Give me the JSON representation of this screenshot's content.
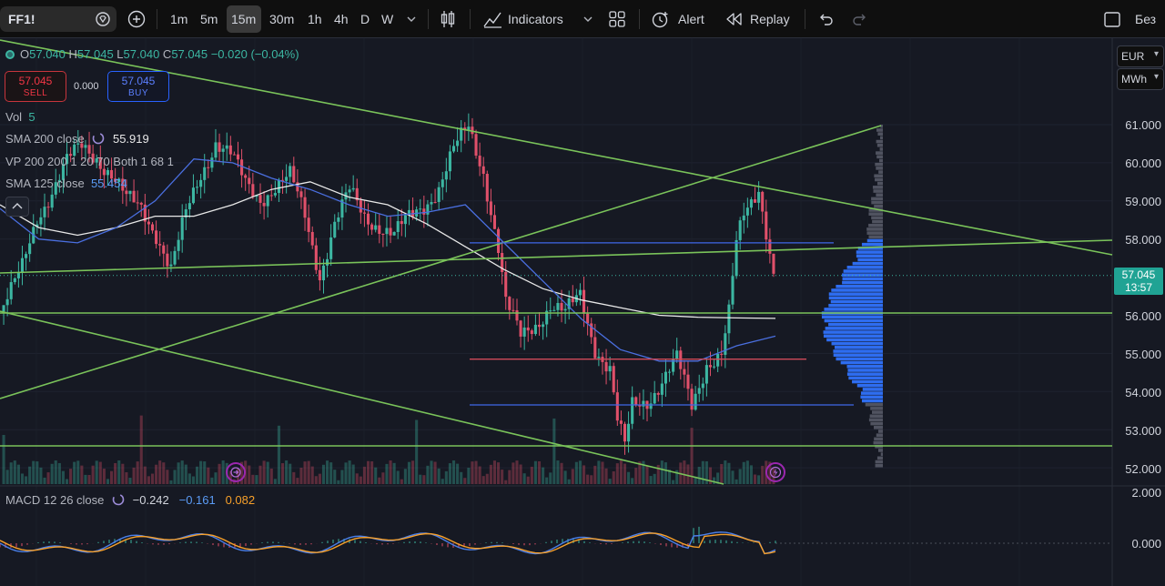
{
  "toolbar": {
    "symbol": "FF1!",
    "timeframes": [
      "1m",
      "5m",
      "15m",
      "30m",
      "1h",
      "4h",
      "D",
      "W"
    ],
    "active_timeframe": "15m",
    "indicators_label": "Indicators",
    "alert_label": "Alert",
    "replay_label": "Replay",
    "layout_label": "Без"
  },
  "legend": {
    "ohlc": {
      "o_label": "O",
      "o": "57.040",
      "h_label": "H",
      "h": "57.045",
      "l_label": "L",
      "l": "57.040",
      "c_label": "C",
      "c": "57.045",
      "change": "−0.020 (−0.04%)"
    },
    "sell_price": "57.045",
    "sell_label": "SELL",
    "buy_price": "57.045",
    "buy_label": "BUY",
    "spread": "0.000",
    "vol_label": "Vol",
    "vol_value": "5",
    "sma200_label": "SMA 200 close",
    "sma200_value": "55.919",
    "vp_label": "VP 200 200 1 20 70 Both 1 68 1",
    "sma125_label": "SMA 125 close",
    "sma125_value": "55.454",
    "macd_label": "MACD 12 26 close",
    "macd_value": "−0.242",
    "signal_value": "−0.161",
    "hist_value": "0.082"
  },
  "axis": {
    "currency": "EUR",
    "unit": "MWh",
    "current_price": "57.045",
    "countdown": "13:57",
    "price_ticks": [
      "61.000",
      "60.000",
      "59.000",
      "58.000",
      "56.000",
      "55.000",
      "54.000",
      "53.000",
      "52.000"
    ],
    "macd_ticks": [
      "2.000",
      "0.000"
    ]
  },
  "colors": {
    "background": "#161923",
    "up": "#3cb6a2",
    "down": "#e0506a",
    "sma200": "#e8e8e8",
    "sma125": "#4a6fe0",
    "trendline": "#7ac35a",
    "level_blue": "#3f67e8",
    "level_red": "#d04a5a",
    "volume_profile": "#2e6df0"
  },
  "chart_data": {
    "type": "line",
    "series": [
      {
        "name": "SMA 200 close",
        "last": 55.919,
        "x": [
          0,
          10,
          20,
          30,
          40,
          50,
          60,
          70,
          80,
          90,
          100,
          110,
          120,
          130,
          140,
          150,
          160,
          170,
          180,
          190,
          200
        ],
        "y": [
          58.9,
          58.3,
          58.1,
          58.3,
          58.6,
          58.6,
          58.9,
          59.3,
          59.5,
          59.1,
          58.9,
          58.4,
          57.8,
          57.2,
          56.7,
          56.4,
          56.2,
          56.0,
          55.95,
          55.93,
          55.919
        ]
      },
      {
        "name": "SMA 125 close",
        "last": 55.454,
        "x": [
          0,
          10,
          20,
          30,
          40,
          50,
          60,
          70,
          80,
          90,
          100,
          110,
          120,
          130,
          140,
          150,
          160,
          170,
          180,
          190,
          200
        ],
        "y": [
          58.8,
          58.0,
          57.9,
          58.3,
          59.0,
          60.1,
          60.0,
          59.6,
          59.3,
          58.9,
          58.6,
          58.7,
          58.9,
          57.9,
          56.9,
          55.9,
          55.1,
          54.8,
          54.8,
          55.2,
          55.454
        ]
      }
    ],
    "levels": {
      "horizontal_blue": [
        57.9,
        53.65
      ],
      "horizontal_red": [
        54.85
      ],
      "horizontal_green": [
        52.55
      ]
    },
    "ylim": [
      51.8,
      62.2
    ],
    "price_ticks": [
      61,
      60,
      59,
      58,
      56,
      55,
      54,
      53,
      52
    ],
    "current_price": 57.045,
    "macd": {
      "macd": -0.242,
      "signal": -0.161,
      "histogram": 0.082,
      "ticks": [
        2.0,
        0.0
      ]
    }
  }
}
